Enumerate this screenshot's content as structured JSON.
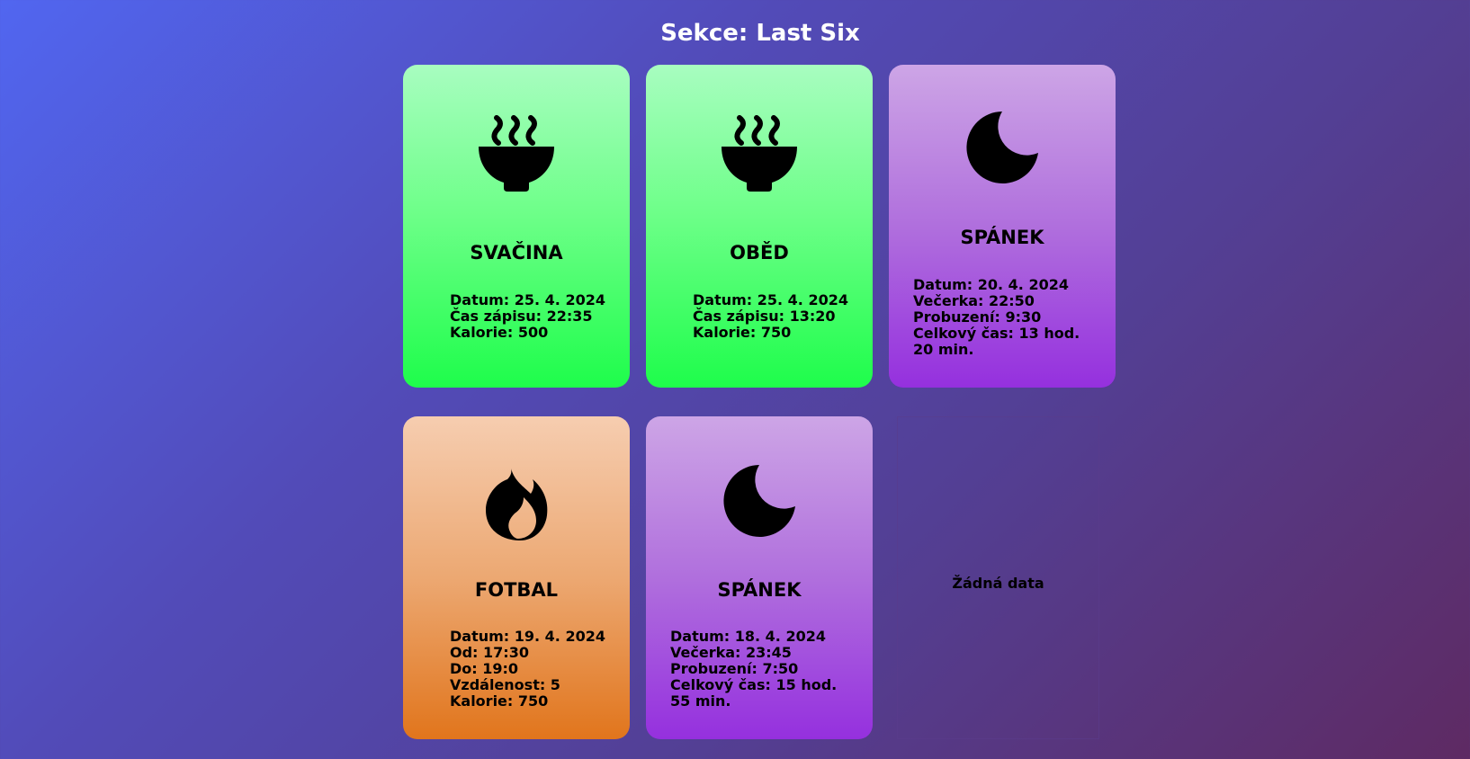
{
  "header": {
    "title": "Sekce: Last Six"
  },
  "cards": [
    {
      "type": "food",
      "icon": "soup-bowl-icon",
      "title": "SVAČINA",
      "lines": [
        "Datum: 25. 4. 2024",
        "Čas zápisu: 22:35",
        "Kalorie: 500"
      ]
    },
    {
      "type": "food",
      "icon": "soup-bowl-icon",
      "title": "OBĚD",
      "lines": [
        "Datum: 25. 4. 2024",
        "Čas zápisu: 13:20",
        "Kalorie: 750"
      ]
    },
    {
      "type": "sleep",
      "icon": "moon-icon",
      "title": "SPÁNEK",
      "lines": [
        "Datum: 20. 4. 2024",
        "Večerka: 22:50",
        "Probuzení: 9:30",
        "Celkový čas: 13 hod. 20 min."
      ]
    },
    {
      "type": "sport",
      "icon": "flame-icon",
      "title": "FOTBAL",
      "lines": [
        "Datum: 19. 4. 2024",
        "Od: 17:30",
        "Do: 19:0",
        "Vzdálenost: 5",
        "Kalorie: 750"
      ]
    },
    {
      "type": "sleep",
      "icon": "moon-icon",
      "title": "SPÁNEK",
      "lines": [
        "Datum: 18. 4. 2024",
        "Večerka: 23:45",
        "Probuzení: 7:50",
        "Celkový čas: 15 hod. 55 min."
      ]
    },
    {
      "type": "empty",
      "text": "Žádná data"
    }
  ],
  "colors": {
    "food": "#1efd4b",
    "sleep": "#9530de",
    "sport": "#e1751c"
  }
}
